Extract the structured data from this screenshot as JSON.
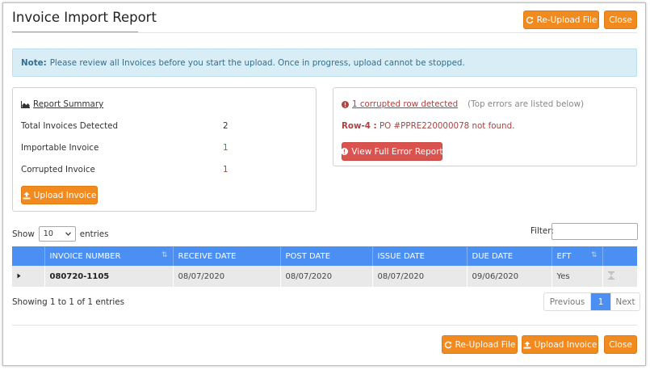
{
  "header": {
    "title": "Invoice Import Report",
    "reupload_label": "Re-Upload File",
    "close_label": "Close"
  },
  "note": {
    "label": "Note:",
    "text": "Please review all Invoices before you start the upload. Once in progress, upload cannot be stopped."
  },
  "summary": {
    "title": "Report Summary",
    "rows": [
      {
        "label": "Total Invoices Detected",
        "value": "2",
        "color": "#333333"
      },
      {
        "label": "Importable Invoice",
        "value": "1",
        "color": "#3c8f3c"
      },
      {
        "label": "Corrupted Invoice",
        "value": "1",
        "color": "#a94442"
      }
    ],
    "upload_label": "Upload Invoice"
  },
  "errors": {
    "link": "1 corrupted row detected",
    "hint": "(Top errors are listed below)",
    "row_label": "Row-4 :",
    "row_text": "PO #PPRE220000078 not found.",
    "view_label": "View Full Error Report"
  },
  "table_controls": {
    "show_label": "Show",
    "show_value": "10",
    "entries_label": "entries",
    "filter_label": "Filter:"
  },
  "table": {
    "columns": [
      "INVOICE NUMBER",
      "RECEIVE DATE",
      "POST DATE",
      "ISSUE DATE",
      "DUE DATE",
      "EFT"
    ],
    "rows": [
      {
        "invoice": "080720-1105",
        "receive": "08/07/2020",
        "post": "08/07/2020",
        "issue": "08/07/2020",
        "due": "09/06/2020",
        "eft": "Yes"
      }
    ]
  },
  "pagination": {
    "showing": "Showing 1 to 1 of 1 entries",
    "previous": "Previous",
    "current": "1",
    "next": "Next"
  },
  "footer": {
    "reupload_label": "Re-Upload File",
    "upload_label": "Upload Invoice",
    "close_label": "Close"
  },
  "colors": {
    "accent": "#f18a1f",
    "table_header": "#4a8ff1",
    "danger": "#d9534f"
  }
}
